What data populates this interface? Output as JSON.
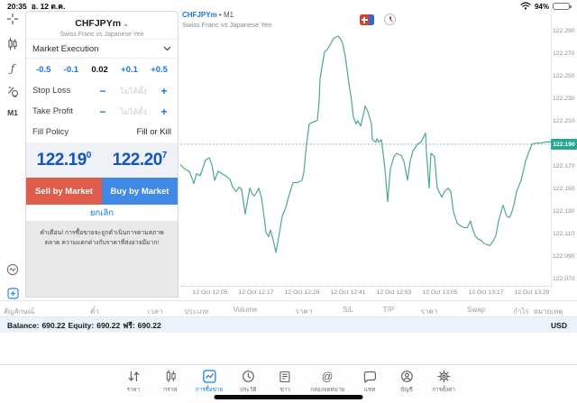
{
  "status_bar": {
    "time": "20:35",
    "date": "อ. 12 ต.ค.",
    "battery_percent": "94%"
  },
  "left_toolbar": {
    "timeframe": "M1"
  },
  "order_panel": {
    "symbol": "CHFJPYm",
    "symbol_description": "Swiss Franc vs Japanese Yen",
    "order_type": "Market Execution",
    "volume": {
      "dec_large": "-0.5",
      "dec_small": "-0.1",
      "value": "0.02",
      "inc_small": "+0.1",
      "inc_large": "+0.5"
    },
    "stop_loss": {
      "label": "Stop Loss",
      "minus": "−",
      "value": "ไม่ได้ตั้ง",
      "plus": "+"
    },
    "take_profit": {
      "label": "Take Profit",
      "minus": "−",
      "value": "ไม่ได้ตั้ง",
      "plus": "+"
    },
    "fill_policy": {
      "label": "Fill Policy",
      "value": "Fill or Kill"
    },
    "bid": {
      "big": "122.19",
      "sup": "0"
    },
    "ask": {
      "big": "122.20",
      "sup": "7"
    },
    "sell_label": "Sell by Market",
    "buy_label": "Buy by Market",
    "cancel_label": "ยกเลิก",
    "warning": "คำเตือน! การซื้อขายจะถูกดำเนินการตามสภาพตลาด ความแตกต่างกับราคาที่ส่งอาจมีมาก!"
  },
  "chart": {
    "symbol": "CHFJPYm",
    "timeframe_label": "• M1",
    "description": "Swiss Franc vs Japanese Yen"
  },
  "chart_data": {
    "type": "line",
    "title": "CHFJPYm M1 line chart",
    "legend": false,
    "grid": false,
    "line_color": "#4fa987",
    "current_price": 122.19,
    "current_price_color": "#29a793",
    "ylim": [
      122.065,
      122.298
    ],
    "y_ticks": [
      122.29,
      122.27,
      122.25,
      122.23,
      122.21,
      122.19,
      122.17,
      122.15,
      122.13,
      122.11,
      122.09,
      122.07
    ],
    "x_tick_labels": [
      "12 Oct 12:05",
      "12 Oct 12:17",
      "12 Oct 12:29",
      "12 Oct 12:41",
      "12 Oct 12:53",
      "12 Oct 13:05",
      "12 Oct 13:17",
      "12 Oct 13:29"
    ],
    "series": [
      {
        "name": "CHFJPYm close",
        "points": [
          [
            0,
            122.172
          ],
          [
            5,
            122.168
          ],
          [
            10,
            122.166
          ],
          [
            13,
            122.16
          ],
          [
            15,
            122.155
          ],
          [
            18,
            122.164
          ],
          [
            22,
            122.162
          ],
          [
            28,
            122.176
          ],
          [
            32,
            122.178
          ],
          [
            35,
            122.172
          ],
          [
            38,
            122.158
          ],
          [
            42,
            122.166
          ],
          [
            46,
            122.164
          ],
          [
            50,
            122.162
          ],
          [
            55,
            122.159
          ],
          [
            58,
            122.152
          ],
          [
            62,
            122.148
          ],
          [
            65,
            122.152
          ],
          [
            68,
            122.15
          ],
          [
            72,
            122.128
          ],
          [
            77,
            122.151
          ],
          [
            80,
            122.146
          ],
          [
            82,
            122.144
          ],
          [
            85,
            122.148
          ],
          [
            87,
            122.151
          ],
          [
            90,
            122.143
          ],
          [
            93,
            122.125
          ],
          [
            95,
            122.112
          ],
          [
            98,
            122.108
          ],
          [
            100,
            122.114
          ],
          [
            103,
            122.105
          ],
          [
            106,
            122.094
          ],
          [
            109,
            122.107
          ],
          [
            113,
            122.126
          ],
          [
            117,
            122.134
          ],
          [
            120,
            122.143
          ],
          [
            125,
            122.156
          ],
          [
            130,
            122.156
          ],
          [
            135,
            122.158
          ],
          [
            137,
            122.165
          ],
          [
            140,
            122.19
          ],
          [
            143,
            122.208
          ],
          [
            148,
            122.21
          ],
          [
            152,
            122.211
          ],
          [
            154,
            122.228
          ],
          [
            155,
            122.248
          ],
          [
            157,
            122.258
          ],
          [
            160,
            122.272
          ],
          [
            163,
            122.274
          ],
          [
            166,
            122.278
          ],
          [
            170,
            122.284
          ],
          [
            175,
            122.286
          ],
          [
            178,
            122.283
          ],
          [
            180,
            122.28
          ],
          [
            183,
            122.268
          ],
          [
            187,
            122.244
          ],
          [
            190,
            122.228
          ],
          [
            192,
            122.214
          ],
          [
            195,
            122.208
          ],
          [
            197,
            122.211
          ],
          [
            200,
            122.206
          ],
          [
            203,
            122.216
          ],
          [
            205,
            122.224
          ],
          [
            208,
            122.219
          ],
          [
            212,
            122.208
          ],
          [
            213,
            122.194
          ],
          [
            217,
            122.192
          ],
          [
            218,
            122.195
          ],
          [
            220,
            122.192
          ],
          [
            223,
            122.194
          ],
          [
            225,
            122.182
          ],
          [
            227,
            122.168
          ],
          [
            230,
            122.139
          ],
          [
            233,
            122.168
          ],
          [
            237,
            122.179
          ],
          [
            240,
            122.182
          ],
          [
            245,
            122.18
          ],
          [
            248,
            122.175
          ],
          [
            252,
            122.158
          ],
          [
            255,
            122.175
          ],
          [
            258,
            122.184
          ],
          [
            263,
            122.19
          ],
          [
            267,
            122.192
          ],
          [
            272,
            122.2
          ],
          [
            273,
            122.183
          ],
          [
            276,
            122.151
          ],
          [
            278,
            122.182
          ],
          [
            282,
            122.179
          ],
          [
            285,
            122.151
          ],
          [
            290,
            122.143
          ],
          [
            293,
            122.148
          ],
          [
            297,
            122.151
          ],
          [
            300,
            122.148
          ],
          [
            303,
            122.13
          ],
          [
            307,
            122.12
          ],
          [
            310,
            122.118
          ],
          [
            315,
            122.116
          ],
          [
            318,
            122.116
          ],
          [
            322,
            122.122
          ],
          [
            323,
            122.118
          ],
          [
            327,
            122.109
          ],
          [
            330,
            122.106
          ],
          [
            333,
            122.105
          ],
          [
            337,
            122.102
          ],
          [
            343,
            122.1
          ],
          [
            347,
            122.104
          ],
          [
            350,
            122.109
          ],
          [
            353,
            122.122
          ],
          [
            358,
            122.136
          ],
          [
            362,
            122.126
          ],
          [
            365,
            122.125
          ],
          [
            367,
            122.128
          ],
          [
            370,
            122.136
          ],
          [
            373,
            122.148
          ],
          [
            378,
            122.158
          ],
          [
            383,
            122.175
          ],
          [
            387,
            122.184
          ],
          [
            390,
            122.19
          ],
          [
            395,
            122.191
          ],
          [
            400,
            122.191
          ],
          [
            405,
            122.192
          ],
          [
            412,
            122.192
          ]
        ]
      }
    ]
  },
  "positions_table": {
    "columns": [
      "สัญลักษณ์",
      "ตั๋ว",
      "เวลา",
      "ประเภท",
      "Volume",
      "ราคา",
      "S/L",
      "T/P",
      "ราคา",
      "Swap",
      "กำไร",
      "หมายเหตุ"
    ]
  },
  "account_bar": {
    "balance_label": "Balance:",
    "balance": "690.22",
    "equity_label": "Equity:",
    "equity": "690.22",
    "free_label": "ฟรี:",
    "free": "690.22",
    "currency": "USD"
  },
  "tab_bar": {
    "tabs": [
      {
        "label": "ราคา"
      },
      {
        "label": "กราฟ"
      },
      {
        "label": "การซื้อขาย"
      },
      {
        "label": "ประวัติ"
      },
      {
        "label": "ข่าว"
      },
      {
        "label": "กล่องจดหมาย"
      },
      {
        "label": "แชท"
      },
      {
        "label": "บัญชี"
      },
      {
        "label": "การตั้งค่า"
      }
    ]
  },
  "colors": {
    "accent_blue": "#1a73e8",
    "sell_red": "#df5b4a",
    "buy_blue": "#4189e6",
    "price_blue": "#1154c2",
    "teal_tag": "#29a793",
    "line_green": "#4fa987"
  }
}
